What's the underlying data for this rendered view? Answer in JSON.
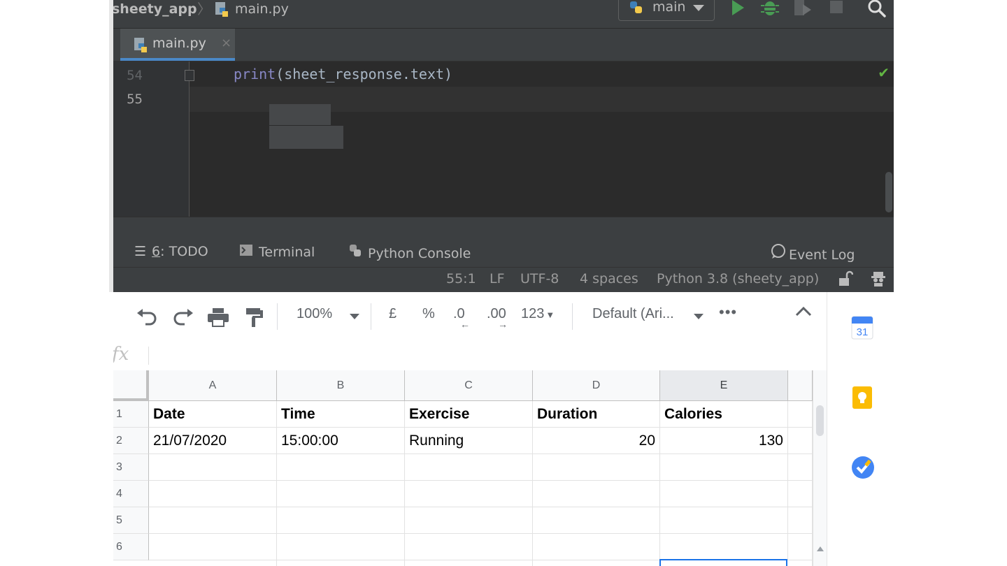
{
  "ide": {
    "breadcrumb": {
      "project": "sheety_app",
      "file": "main.py"
    },
    "run_config": {
      "label": "main"
    },
    "toolbar_icons": [
      "run-icon",
      "debug-icon",
      "coverage-icon",
      "stop-icon",
      "search-icon"
    ],
    "tab": {
      "label": "main.py",
      "close": "×"
    },
    "editor": {
      "lines": [
        {
          "number": "54",
          "code_fn": "print",
          "code_rest": "(sheet_response.text)"
        },
        {
          "number": "55",
          "code_fn": "",
          "code_rest": ""
        }
      ]
    },
    "tool_windows": {
      "todo_prefix": "6",
      "todo_label": ": TODO",
      "terminal": "Terminal",
      "python_console": "Python Console",
      "event_log": "Event Log"
    },
    "status_bar": {
      "position": "55:1",
      "line_ending": "LF",
      "encoding": "UTF-8",
      "indent": "4 spaces",
      "interpreter": "Python 3.8 (sheety_app)"
    }
  },
  "sheets": {
    "toolbar": {
      "zoom": "100%",
      "currency": "£",
      "percent": "%",
      "decrease_decimal": ".0",
      "increase_decimal": ".00",
      "more_formats": "123",
      "font": "Default (Ari...",
      "more": "•••"
    },
    "formula_bar": {
      "fx": "fx",
      "value": ""
    },
    "columns": [
      "A",
      "B",
      "C",
      "D",
      "E"
    ],
    "rows": [
      "1",
      "2",
      "3",
      "4",
      "5",
      "6"
    ],
    "header_row": [
      "Date",
      "Time",
      "Exercise",
      "Duration",
      "Calories"
    ],
    "data_rows": [
      [
        "21/07/2020",
        "15:00:00",
        "Running",
        "20",
        "130"
      ]
    ],
    "selected_column": "E"
  },
  "side_panel": {
    "calendar_day": "31",
    "apps": [
      "calendar-icon",
      "keep-icon",
      "tasks-icon"
    ]
  }
}
